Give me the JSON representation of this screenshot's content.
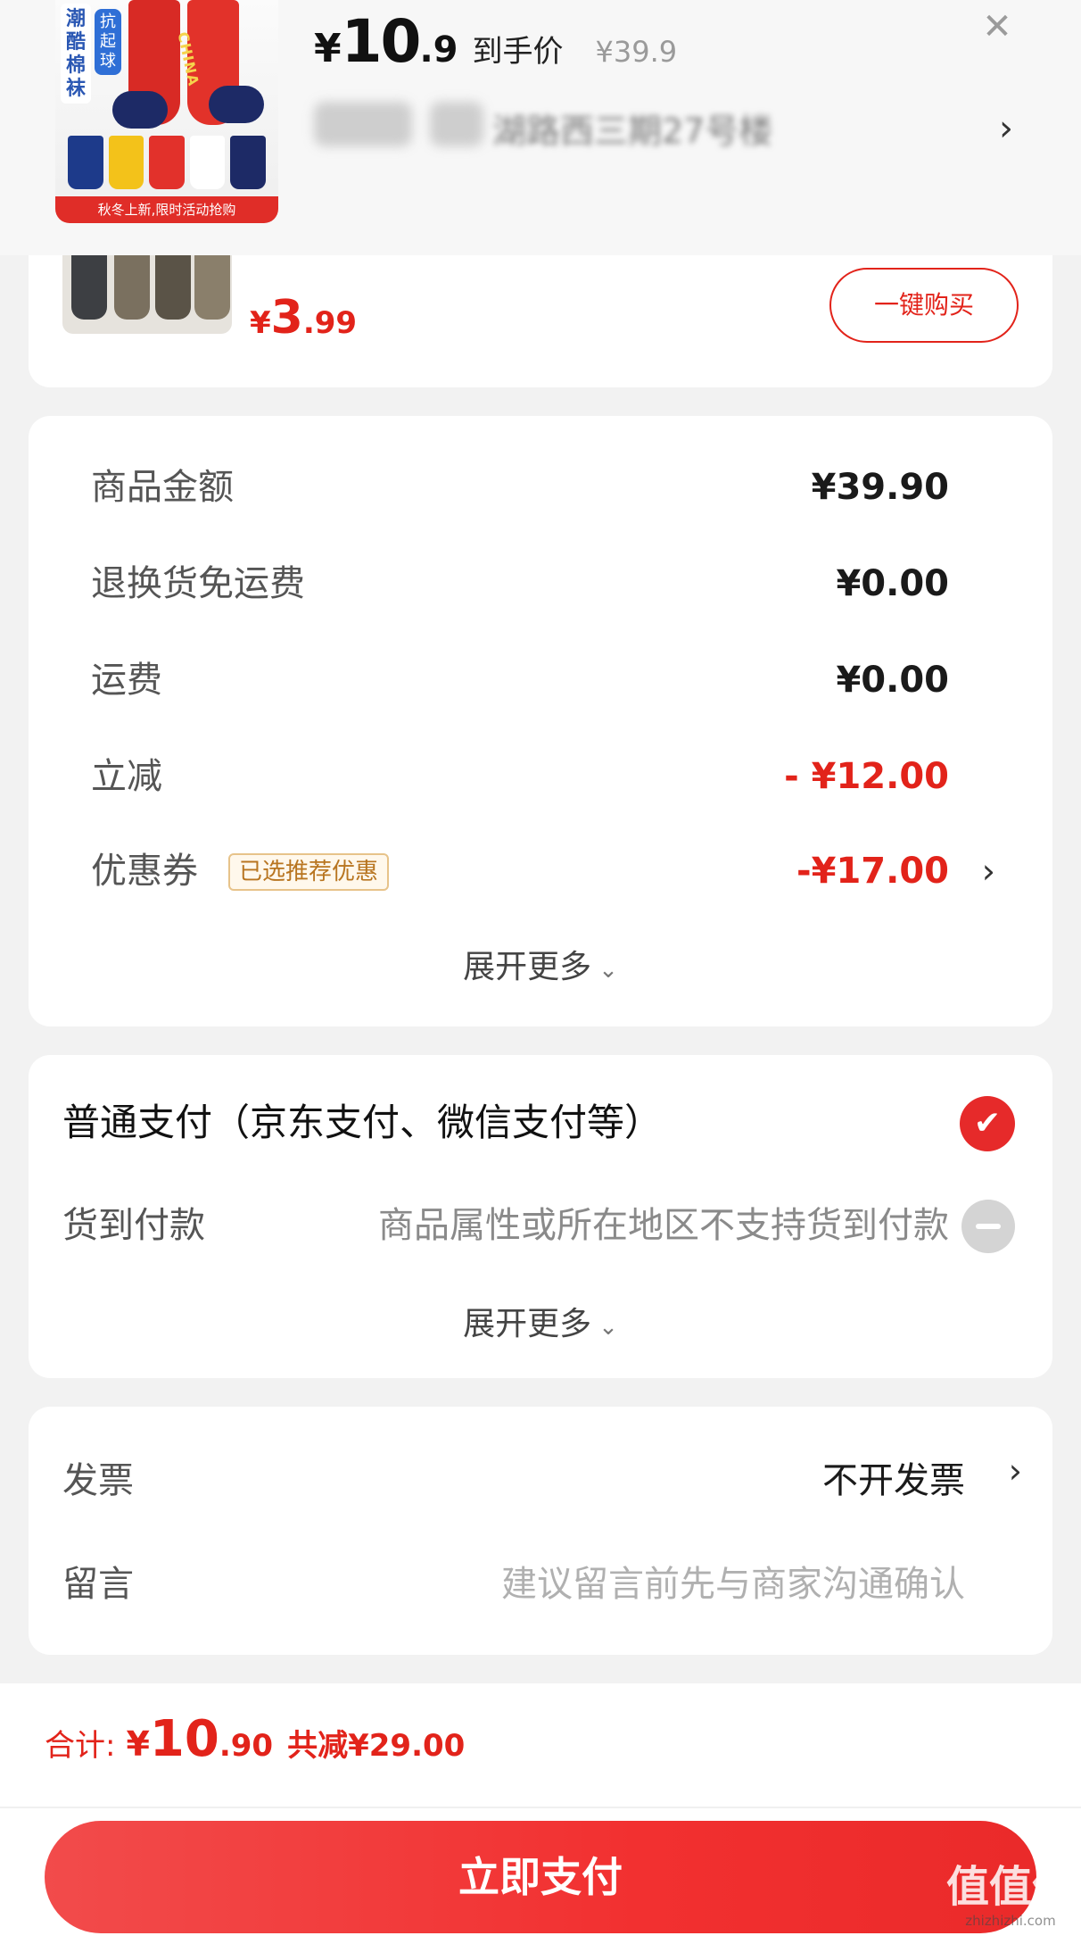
{
  "header": {
    "thumbnail": {
      "tag": "潮酷棉袜",
      "badge": "抗起球",
      "sock_text": "CHINA",
      "promo": "秋冬上新,限时活动抢购",
      "mini_sock_colors": [
        "#1d3a8a",
        "#f3c21a",
        "#e2312b",
        "#ffffff",
        "#1d2a66"
      ]
    },
    "price": {
      "currency": "¥",
      "integer": "10",
      "decimal": ".9",
      "label": "到手价",
      "original": "¥39.9"
    },
    "close_icon": "close-icon",
    "address": {
      "text": "湖路西三期27号楼"
    },
    "chevron": "›"
  },
  "promo_card": {
    "price": {
      "currency": "¥",
      "integer": "3",
      "decimal": ".99"
    },
    "buy_button": "一键购买"
  },
  "summary": {
    "rows": [
      {
        "label": "商品金额",
        "value": "¥39.90",
        "tone": "normal"
      },
      {
        "label": "退换货免运费",
        "value": "¥0.00",
        "tone": "normal"
      },
      {
        "label": "运费",
        "value": "¥0.00",
        "tone": "normal"
      },
      {
        "label": "立减",
        "value": "- ¥12.00",
        "tone": "red"
      }
    ],
    "coupon": {
      "label": "优惠券",
      "tag": "已选推荐优惠",
      "value": "-¥17.00",
      "chevron": "›"
    },
    "expand": "展开更多",
    "expand_chevron": "⌄"
  },
  "payment": {
    "title": "普通支付（京东支付、微信支付等）",
    "check_icon": "✔",
    "cod_label": "货到付款",
    "cod_note": "商品属性或所在地区不支持货到付款",
    "expand": "展开更多",
    "expand_chevron": "⌄"
  },
  "misc": {
    "invoice_label": "发票",
    "invoice_value": "不开发票",
    "chevron": "›",
    "message_label": "留言",
    "message_placeholder": "建议留言前先与商家沟通确认"
  },
  "footer": {
    "total_label": "合计:",
    "total_currency": "¥",
    "total_integer": "10",
    "total_decimal": ".90",
    "saved": "共减¥29.00",
    "pay_button": "立即支付"
  },
  "watermark": {
    "main": "值值值",
    "sub": "zhizhizhi.com"
  },
  "colors": {
    "accent": "#e2231a",
    "button": "#f23030",
    "coupon_tag": "#b87520"
  }
}
